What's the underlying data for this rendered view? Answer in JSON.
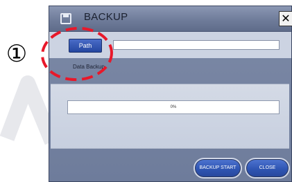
{
  "annotation": {
    "number": "①"
  },
  "dialog": {
    "title": "BACKUP",
    "close_glyph": "✕",
    "title_icon": "save-disk-icon",
    "path_button": "Path",
    "path_value": "",
    "section_label": "Data Backup",
    "progress": {
      "value": 0,
      "text": "0%"
    },
    "start_button": "BACKUP START",
    "close_button": "CLOSE"
  },
  "colors": {
    "dialog_bg": "#7d8aa7",
    "button_blue": "#2f55b3",
    "callout_red": "#e8182a",
    "watermark": "#e9e9ea"
  }
}
